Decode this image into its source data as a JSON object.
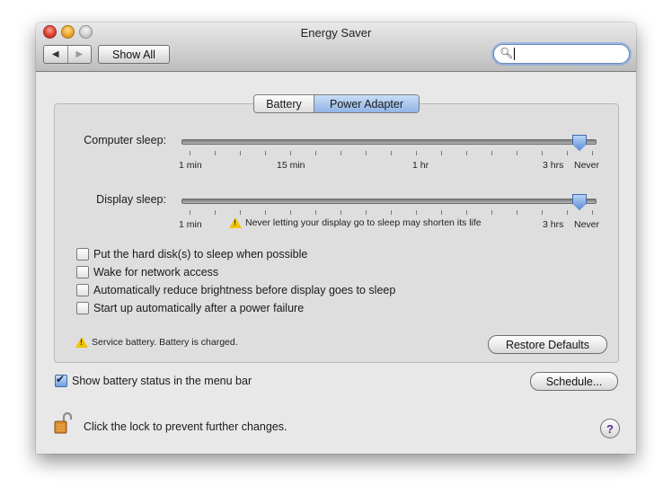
{
  "window": {
    "title": "Energy Saver"
  },
  "toolbar": {
    "back_glyph": "◀",
    "forward_glyph": "▶",
    "show_all_label": "Show All",
    "search_value": ""
  },
  "tabs": [
    {
      "label": "Battery",
      "selected": false
    },
    {
      "label": "Power Adapter",
      "selected": true
    }
  ],
  "computer_sleep": {
    "label": "Computer sleep:",
    "value": "Never",
    "ticks": {
      "min": "1 min",
      "mid1": "15 min",
      "mid2": "1 hr",
      "max": "3 hrs",
      "never": "Never"
    }
  },
  "display_sleep": {
    "label": "Display sleep:",
    "value": "Never",
    "ticks": {
      "min": "1 min",
      "max": "3 hrs",
      "never": "Never"
    },
    "warning": "Never letting your display go to sleep may shorten its life"
  },
  "options": [
    {
      "label": "Put the hard disk(s) to sleep when possible",
      "checked": false
    },
    {
      "label": "Wake for network access",
      "checked": false
    },
    {
      "label": "Automatically reduce brightness before display goes to sleep",
      "checked": false
    },
    {
      "label": "Start up automatically after a power failure",
      "checked": false
    }
  ],
  "battery_status": "Service battery. Battery is charged.",
  "restore_defaults_label": "Restore Defaults",
  "show_battery_status": {
    "label": "Show battery status in the menu bar",
    "checked": true
  },
  "schedule_label": "Schedule...",
  "lock_text": "Click the lock to prevent further changes.",
  "help_label": "?",
  "colors": {
    "accent": "#6f9ee0",
    "warning": "#f2c200"
  }
}
